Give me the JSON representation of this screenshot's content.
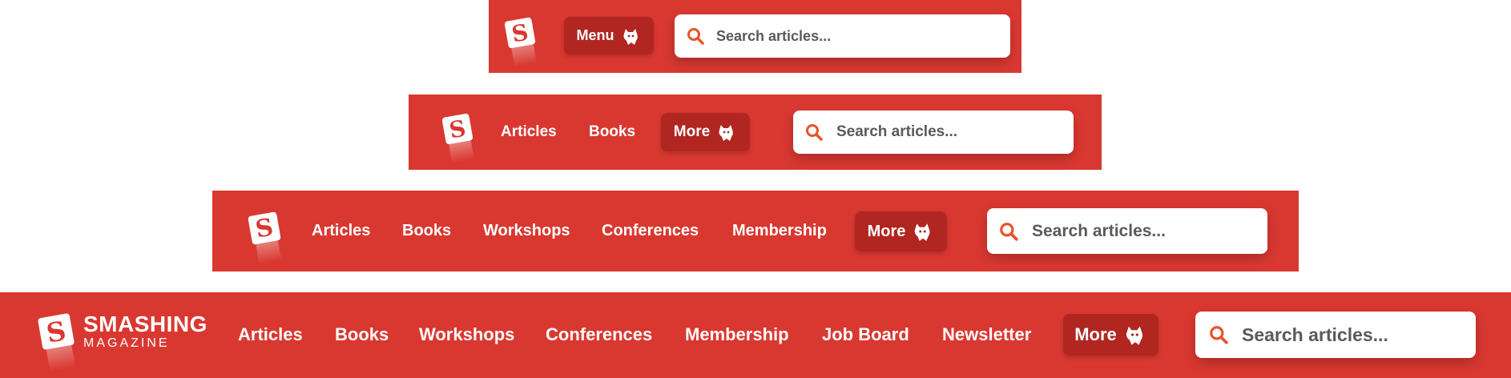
{
  "colors": {
    "bar_red": "#d93831",
    "button_dark_red": "#b12621",
    "search_icon_orange": "#e8542b",
    "text_white": "#ffffff"
  },
  "icons": {
    "logo": "smashing-s-logo-icon",
    "more": "cat-icon",
    "search": "search-icon"
  },
  "bar1": {
    "menu_label": "Menu",
    "search_placeholder": "Search articles..."
  },
  "bar2": {
    "nav": [
      "Articles",
      "Books"
    ],
    "more_label": "More",
    "search_placeholder": "Search articles..."
  },
  "bar3": {
    "nav": [
      "Articles",
      "Books",
      "Workshops",
      "Conferences",
      "Membership"
    ],
    "more_label": "More",
    "search_placeholder": "Search articles..."
  },
  "bar4": {
    "brand": {
      "line1": "SMASHING",
      "line2": "MAGAZINE"
    },
    "nav": [
      "Articles",
      "Books",
      "Workshops",
      "Conferences",
      "Membership",
      "Job Board",
      "Newsletter"
    ],
    "more_label": "More",
    "search_placeholder": "Search articles..."
  }
}
